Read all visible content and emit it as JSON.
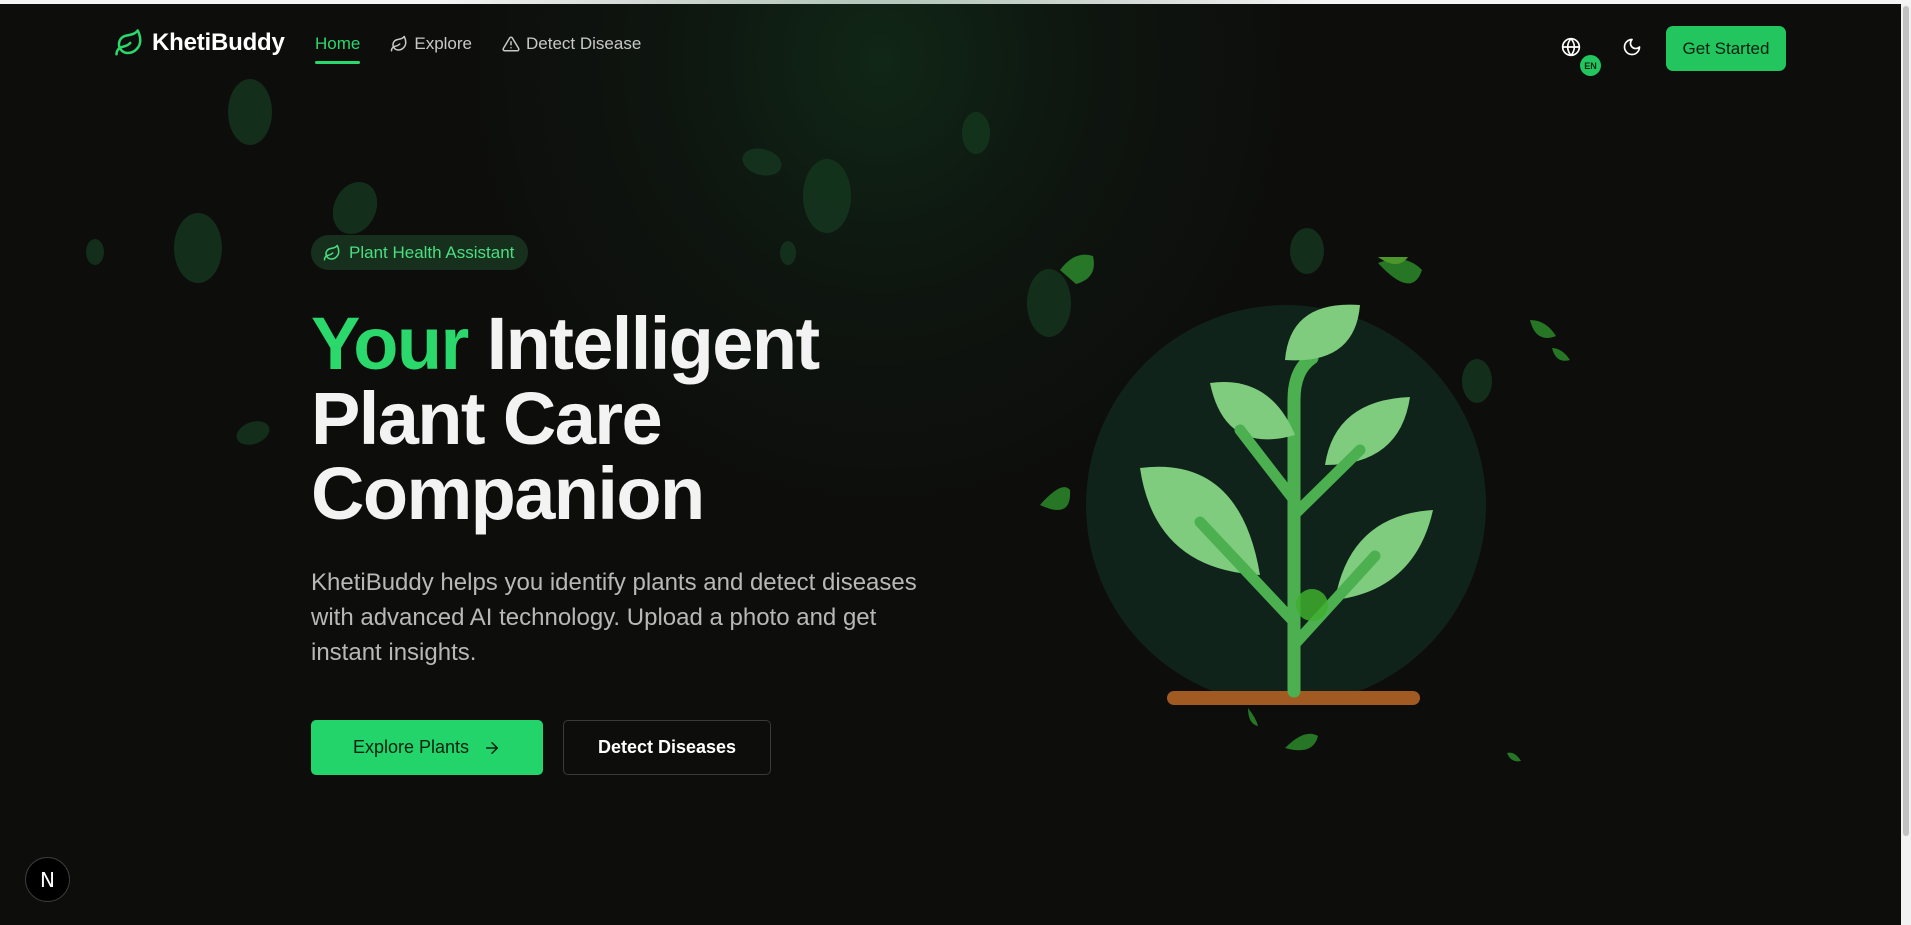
{
  "brand": {
    "name": "KhetiBuddy"
  },
  "nav": {
    "links": [
      {
        "label": "Home",
        "active": true
      },
      {
        "label": "Explore",
        "icon": "leaf-icon"
      },
      {
        "label": "Detect Disease",
        "icon": "warning-triangle-icon"
      }
    ],
    "language_badge": "EN",
    "cta_label": "Get Started"
  },
  "hero": {
    "badge_label": "Plant Health Assistant",
    "headline_accent": "Your",
    "headline_rest": "Intelligent Plant Care Companion",
    "subtext": "KhetiBuddy helps you identify plants and detect diseases with advanced AI technology. Upload a photo and get instant insights.",
    "primary_button": "Explore Plants",
    "secondary_button": "Detect Diseases"
  },
  "dev_indicator": {
    "label": "N"
  },
  "colors": {
    "accent": "#22c55e",
    "background": "#0d0d0c",
    "plant_leaf": "#7fcc7f",
    "plant_stem": "#4cb050",
    "soil": "#a05a22"
  }
}
